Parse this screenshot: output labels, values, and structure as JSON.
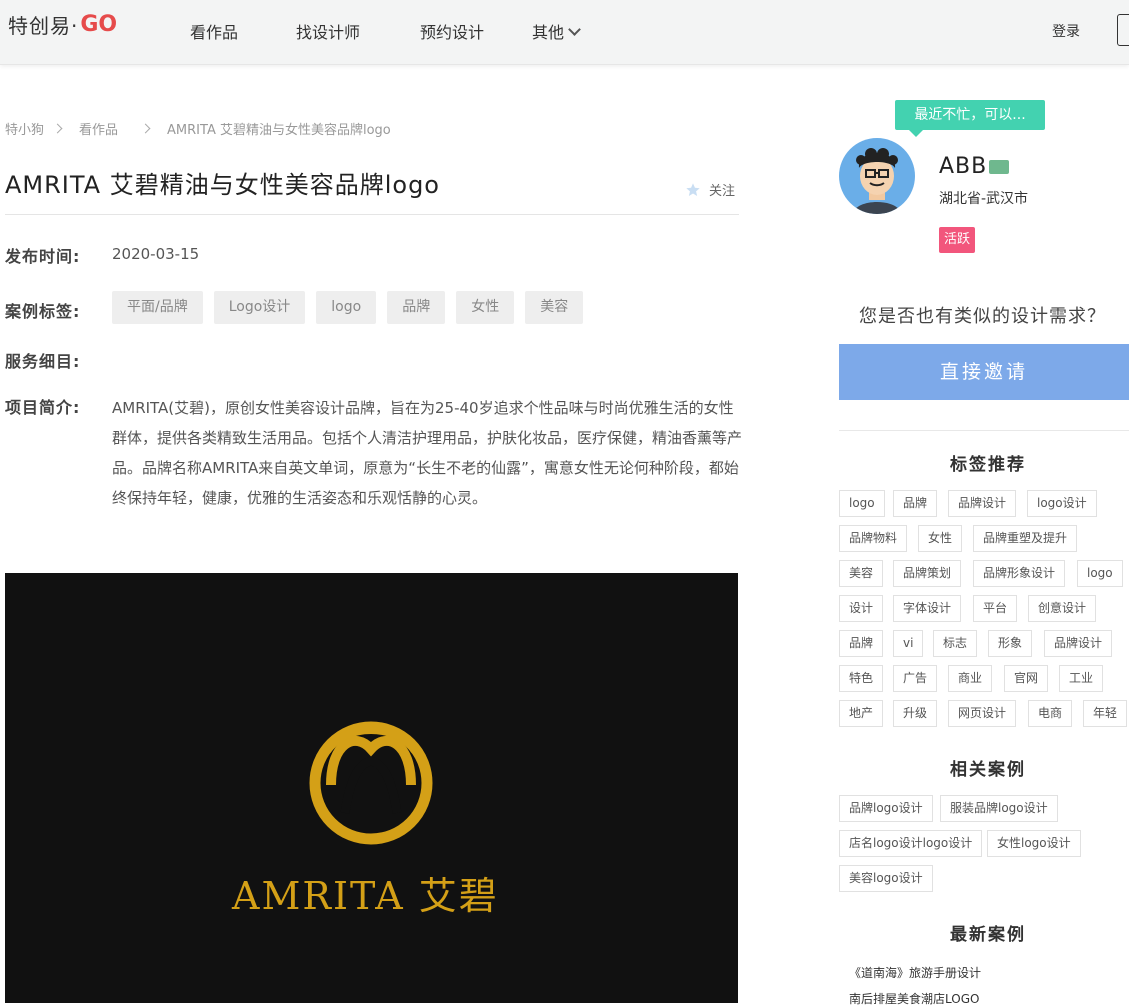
{
  "header": {
    "logo_cn": "特创易·",
    "logo_go": "GO",
    "nav": [
      {
        "label": "看作品"
      },
      {
        "label": "找设计师"
      },
      {
        "label": "预约设计"
      },
      {
        "label": "其他"
      }
    ],
    "login": "登录"
  },
  "breadcrumb": [
    "特小狗",
    "看作品",
    "AMRITA 艾碧精油与女性美容品牌logo"
  ],
  "title": "AMRITA 艾碧精油与女性美容品牌logo",
  "follow_label": "关注",
  "publish": {
    "label": "发布时间:",
    "value": "2020-03-15"
  },
  "case_tags": {
    "label": "案例标签:",
    "items": [
      "平面/品牌",
      "Logo设计",
      "logo",
      "品牌",
      "女性",
      "美容"
    ]
  },
  "service": {
    "label": "服务细目:"
  },
  "intro": {
    "label": "项目简介:",
    "text": "AMRITA(艾碧)，原创女性美容设计品牌，旨在为25-40岁追求个性品味与时尚优雅生活的女性群体，提供各类精致生活用品。包括个人清洁护理用品，护肤化妆品，医疗保健，精油香薰等产品。品牌名称AMRITA来自英文单词，原意为“长生不老的仙露”，寓意女性无论何种阶段，都始终保持年轻，健康，优雅的生活姿态和乐观恬静的心灵。"
  },
  "hero": {
    "brand_text": "AMRITA 艾碧",
    "logo_color": "#d4a017",
    "bg_color": "#111111"
  },
  "designer": {
    "bubble": "最近不忙，可以...",
    "name": "ABB",
    "location": "湖北省-武汉市",
    "badge": "活跃"
  },
  "cta": {
    "question": "您是否也有类似的设计需求？",
    "invite": "直接邀请"
  },
  "tag_recommend": {
    "heading": "标签推荐",
    "rows": [
      [
        "logo",
        "品牌",
        "品牌设计",
        "logo设计"
      ],
      [
        "品牌物料",
        "女性",
        "品牌重塑及提升"
      ],
      [
        "美容",
        "品牌策划",
        "品牌形象设计",
        "logo"
      ],
      [
        "设计",
        "字体设计",
        "平台",
        "创意设计"
      ],
      [
        "品牌",
        "vi",
        "标志",
        "形象",
        "品牌设计"
      ],
      [
        "特色",
        "广告",
        "商业",
        "官网",
        "工业"
      ],
      [
        "地产",
        "升级",
        "网页设计",
        "电商",
        "年轻"
      ]
    ]
  },
  "related": {
    "heading": "相关案例",
    "rows": [
      [
        "品牌logo设计",
        "服装品牌logo设计"
      ],
      [
        "店名logo设计logo设计",
        "女性logo设计"
      ],
      [
        "美容logo设计"
      ]
    ]
  },
  "latest": {
    "heading": "最新案例",
    "items": [
      "《道南海》旅游手册设计",
      "南后排屋美食潮店LOGO"
    ]
  },
  "colors": {
    "accent_blue": "#7da9e9",
    "bubble_green": "#43d2b0",
    "badge_pink": "#f2567c",
    "gold": "#d4a017"
  }
}
